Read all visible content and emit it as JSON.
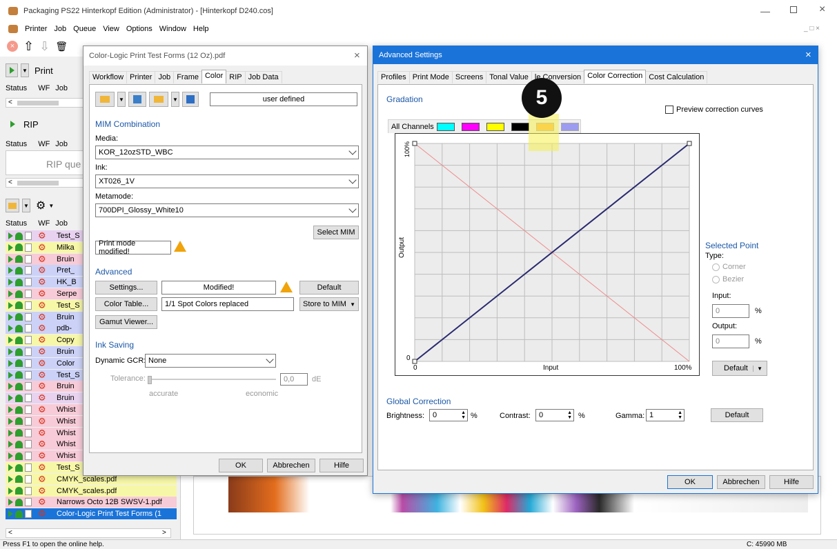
{
  "main_window": {
    "title": "Packaging PS22 Hinterkopf Edition (Administrator) - [Hinterkopf D240.cos]",
    "menu": [
      "Printer",
      "Job",
      "Queue",
      "View",
      "Options",
      "Window",
      "Help"
    ],
    "status_bar": {
      "help": "Press F1 to open the online help.",
      "memory": "C: 45990 MB"
    }
  },
  "left_panel": {
    "print_label": "Print",
    "rip_label": "RIP",
    "rip_queue_placeholder": "RIP que",
    "columns": {
      "status": "Status",
      "wf": "WF",
      "job": "Job"
    },
    "jobs": [
      {
        "name": "Test_S",
        "color": "#e8d2f0"
      },
      {
        "name": "Milka",
        "color": "#f7f7a8"
      },
      {
        "name": "Bruin",
        "color": "#f7cbd8"
      },
      {
        "name": "Pret_",
        "color": "#ccd2f7"
      },
      {
        "name": "HK_B",
        "color": "#ccd2f7"
      },
      {
        "name": "Serpe",
        "color": "#f7cbd8"
      },
      {
        "name": "Test_S",
        "color": "#f7f7a8"
      },
      {
        "name": "Bruin",
        "color": "#ccd2f7"
      },
      {
        "name": "pdb-",
        "color": "#ccd2f7"
      },
      {
        "name": "Copy",
        "color": "#f7f7a8"
      },
      {
        "name": "Bruin",
        "color": "#ccd2f7"
      },
      {
        "name": "Color",
        "color": "#ccd2f7"
      },
      {
        "name": "Test_S",
        "color": "#ccd2f7"
      },
      {
        "name": "Bruin",
        "color": "#f7cbd8"
      },
      {
        "name": "Bruin",
        "color": "#e8d2f0"
      },
      {
        "name": "Whist",
        "color": "#f7cbd8"
      },
      {
        "name": "Whist",
        "color": "#f7cbd8"
      },
      {
        "name": "Whist",
        "color": "#f7cbd8"
      },
      {
        "name": "Whist",
        "color": "#f7cbd8"
      },
      {
        "name": "Whist",
        "color": "#f7cbd8"
      },
      {
        "name": "Test_S",
        "color": "#f7f7a8"
      },
      {
        "name": "CMYK_scales.pdf",
        "color": "#f7f7a8"
      },
      {
        "name": "CMYK_scales.pdf",
        "color": "#f7f7a8"
      },
      {
        "name": "Narrows Octo 12B SWSV-1.pdf",
        "color": "#f7cbd8"
      },
      {
        "name": "Color-Logic Print Test Forms (1",
        "color": "#1a73d9"
      }
    ]
  },
  "job_dialog": {
    "title": "Color-Logic Print Test Forms (12 Oz).pdf",
    "tabs": [
      "Workflow",
      "Printer",
      "Job",
      "Frame",
      "Color",
      "RIP",
      "Job Data"
    ],
    "active_tab": "Color",
    "preset_value": "user defined",
    "mim_title": "MIM Combination",
    "media_label": "Media:",
    "media_value": "KOR_12ozSTD_WBC",
    "ink_label": "Ink:",
    "ink_value": "XT026_1V",
    "metamode_label": "Metamode:",
    "metamode_value": "700DPI_Glossy_White10",
    "select_mim": "Select MIM",
    "print_mode_modified": "Print mode modified!",
    "advanced_title": "Advanced",
    "settings_btn": "Settings...",
    "settings_status": "Modified!",
    "default_btn": "Default",
    "color_table_btn": "Color Table...",
    "color_table_status": "1/1 Spot Colors replaced",
    "store_to_mim": "Store to MIM",
    "gamut_viewer_btn": "Gamut Viewer...",
    "ink_saving_title": "Ink Saving",
    "dynamic_gcr_label": "Dynamic GCR:",
    "dynamic_gcr_value": "None",
    "tolerance_label": "Tolerance:",
    "tolerance_value": "0,0",
    "tolerance_unit": "dE",
    "slider_min": "accurate",
    "slider_max": "economic",
    "ok": "OK",
    "cancel": "Abbrechen",
    "help": "Hilfe"
  },
  "adv_dialog": {
    "title": "Advanced Settings",
    "tabs": [
      "Profiles",
      "Print Mode",
      "Screens",
      "Tonal Value",
      "le Conversion",
      "Color Correction",
      "Cost Calculation"
    ],
    "active_tab": "Color Correction",
    "step_badge": "5",
    "gradation_title": "Gradation",
    "preview_label": "Preview correction curves",
    "all_channels": "All Channels",
    "channel_colors": [
      "#00ffff",
      "#ff00ff",
      "#ffff00",
      "#000000",
      "#ffb14a",
      "#9c9cf0"
    ],
    "chart": {
      "x_label": "Input",
      "y_label": "Output",
      "x_min": "0",
      "x_max": "100%",
      "y_min": "0",
      "y_max": "100%"
    },
    "selected_point_title": "Selected Point",
    "type_label": "Type:",
    "corner_label": "Corner",
    "bezier_label": "Bezier",
    "input_label": "Input:",
    "input_value": "0",
    "output_label": "Output:",
    "output_value": "0",
    "percent": "%",
    "default_btn": "Default",
    "global_title": "Global Correction",
    "brightness_label": "Brightness:",
    "brightness_value": "0",
    "contrast_label": "Contrast:",
    "contrast_value": "0",
    "gamma_label": "Gamma:",
    "gamma_value": "1",
    "global_default": "Default",
    "ok": "OK",
    "cancel": "Abbrechen",
    "help": "Hilfe"
  },
  "colors": {
    "accent_blue": "#1b58a8",
    "title_blue": "#1a73d9",
    "highlight_yellow": "#f5f06a",
    "warning_orange": "#f0a30a"
  }
}
